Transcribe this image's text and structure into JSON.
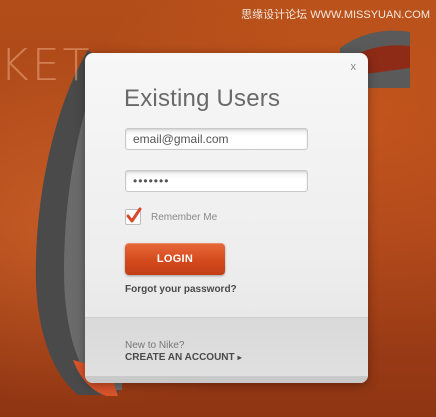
{
  "watermark": "思缘设计论坛 WWW.MISSYUAN.COM",
  "background": {
    "brand_fragment": "KET"
  },
  "modal": {
    "close_label": "x",
    "title": "Existing Users",
    "email_value": "email@gmail.com",
    "password_value": "•••••••",
    "remember_label": "Remember Me",
    "remember_checked": true,
    "login_label": "LOGIN",
    "forgot_label": "Forgot your password?",
    "new_to_label": "New to Nike?",
    "create_account_label": "CREATE AN ACCOUNT",
    "chevron_icon": "chevron-right-icon"
  },
  "colors": {
    "background": "#b04a18",
    "login_button": "#d44a1d",
    "checkmark": "#d9472b"
  }
}
